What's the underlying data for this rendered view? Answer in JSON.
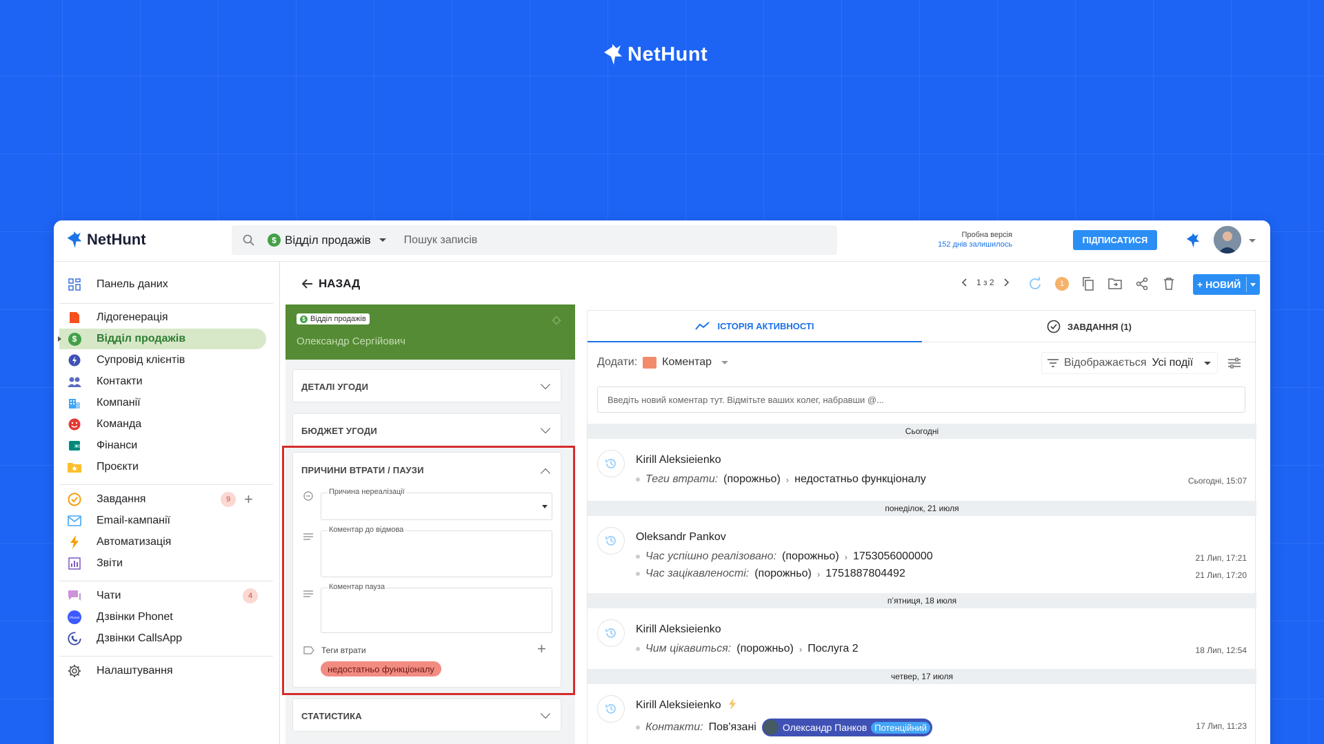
{
  "brand": {
    "name": "NetHunt"
  },
  "header": {
    "crm_name": "Відділ продажів",
    "search_placeholder": "Пошук записів",
    "trial_line1": "Пробна версія",
    "trial_line2": "152 днів залишилось",
    "subscribe_label": "ПІДПИСАТИСЯ"
  },
  "sidebar": {
    "dashboard": "Панель даних",
    "items": [
      {
        "label": "Лідогенерація",
        "icon": "lead-icon",
        "color": "#f4511e"
      },
      {
        "label": "Відділ продажів",
        "icon": "dollar-icon",
        "color": "#43a047"
      },
      {
        "label": "Супровід клієнтів",
        "icon": "bolt-circle-icon",
        "color": "#3f51b5"
      },
      {
        "label": "Контакти",
        "icon": "people-icon",
        "color": "#5c6bc0"
      },
      {
        "label": "Компанії",
        "icon": "building-icon",
        "color": "#42a5f5"
      },
      {
        "label": "Команда",
        "icon": "smile-icon",
        "color": "#e53935"
      },
      {
        "label": "Фінанси",
        "icon": "wallet-icon",
        "color": "#00897b"
      },
      {
        "label": "Проєкти",
        "icon": "folder-star-icon",
        "color": "#fbc02d"
      }
    ],
    "tasks": "Завдання",
    "tasks_badge": "9",
    "email": "Email-кампанії",
    "automation": "Автоматизація",
    "reports": "Звіти",
    "chats": "Чати",
    "chats_badge": "4",
    "phonet": "Дзвінки Phonet",
    "phonet_logo": "Phonet",
    "callsapp": "Дзвінки CallsApp",
    "settings": "Налаштування"
  },
  "toolbar": {
    "back_label": "НАЗАД",
    "pager": "1 з 2",
    "notif_count": "1",
    "new_label": "+ НОВИЙ"
  },
  "record": {
    "folder_tag": "Відділ продажів",
    "name": "Олександр Сергійович",
    "sections": {
      "details": "ДЕТАЛІ УГОДИ",
      "budget": "БЮДЖЕТ УГОДИ",
      "loss": "ПРИЧИНИ ВТРАТИ / ПАУЗИ",
      "stats": "СТАТИСТИКА"
    },
    "fields": {
      "reason_label": "Причина нереалізації",
      "reason_value": "",
      "refusal_label": "Коментар до відмова",
      "pause_label": "Коментар пауза",
      "tags_label": "Теги втрати",
      "tag_value": "недостатньо функціоналу"
    }
  },
  "activity": {
    "tab_history": "ІСТОРІЯ АКТИВНОСТІ",
    "tab_tasks": "ЗАВДАННЯ (1)",
    "add_label": "Додати:",
    "add_type": "Коментар",
    "filter_prefix": "Відображається",
    "filter_value": "Усі події",
    "comment_placeholder": "Введіть новий коментар тут. Відмітьте ваших колег, набравши @...",
    "days": [
      {
        "title": "Сьогодні"
      },
      {
        "title": "понеділок, 21 июля"
      },
      {
        "title": "пʼятниця, 18 июля"
      },
      {
        "title": "четвер, 17 июля"
      }
    ],
    "entries": [
      {
        "user": "Kirill Aleksieienko",
        "field": "Теги втрати:",
        "from": "(порожньо)",
        "to": "недостатньо функціоналу",
        "time": "Сьогодні, 15:07"
      },
      {
        "user": "Oleksandr Pankov",
        "field": "Час успішно реалізовано:",
        "from": "(порожньо)",
        "to": "1753056000000",
        "time": "21 Лип, 17:21",
        "field2": "Час зацікавленості:",
        "from2": "(порожньо)",
        "to2": "1751887804492",
        "time2": "21 Лип, 17:20"
      },
      {
        "user": "Kirill Aleksieienko",
        "field": "Чим цікавиться:",
        "from": "(порожньо)",
        "to": "Послуга 2",
        "time": "18 Лип, 12:54"
      },
      {
        "user": "Kirill Aleksieienko",
        "field": "Контакти:",
        "from": "Пов'язані",
        "contact": "Олександр Панков",
        "status": "Потенційний",
        "time": "17 Лип, 11:23"
      }
    ]
  }
}
